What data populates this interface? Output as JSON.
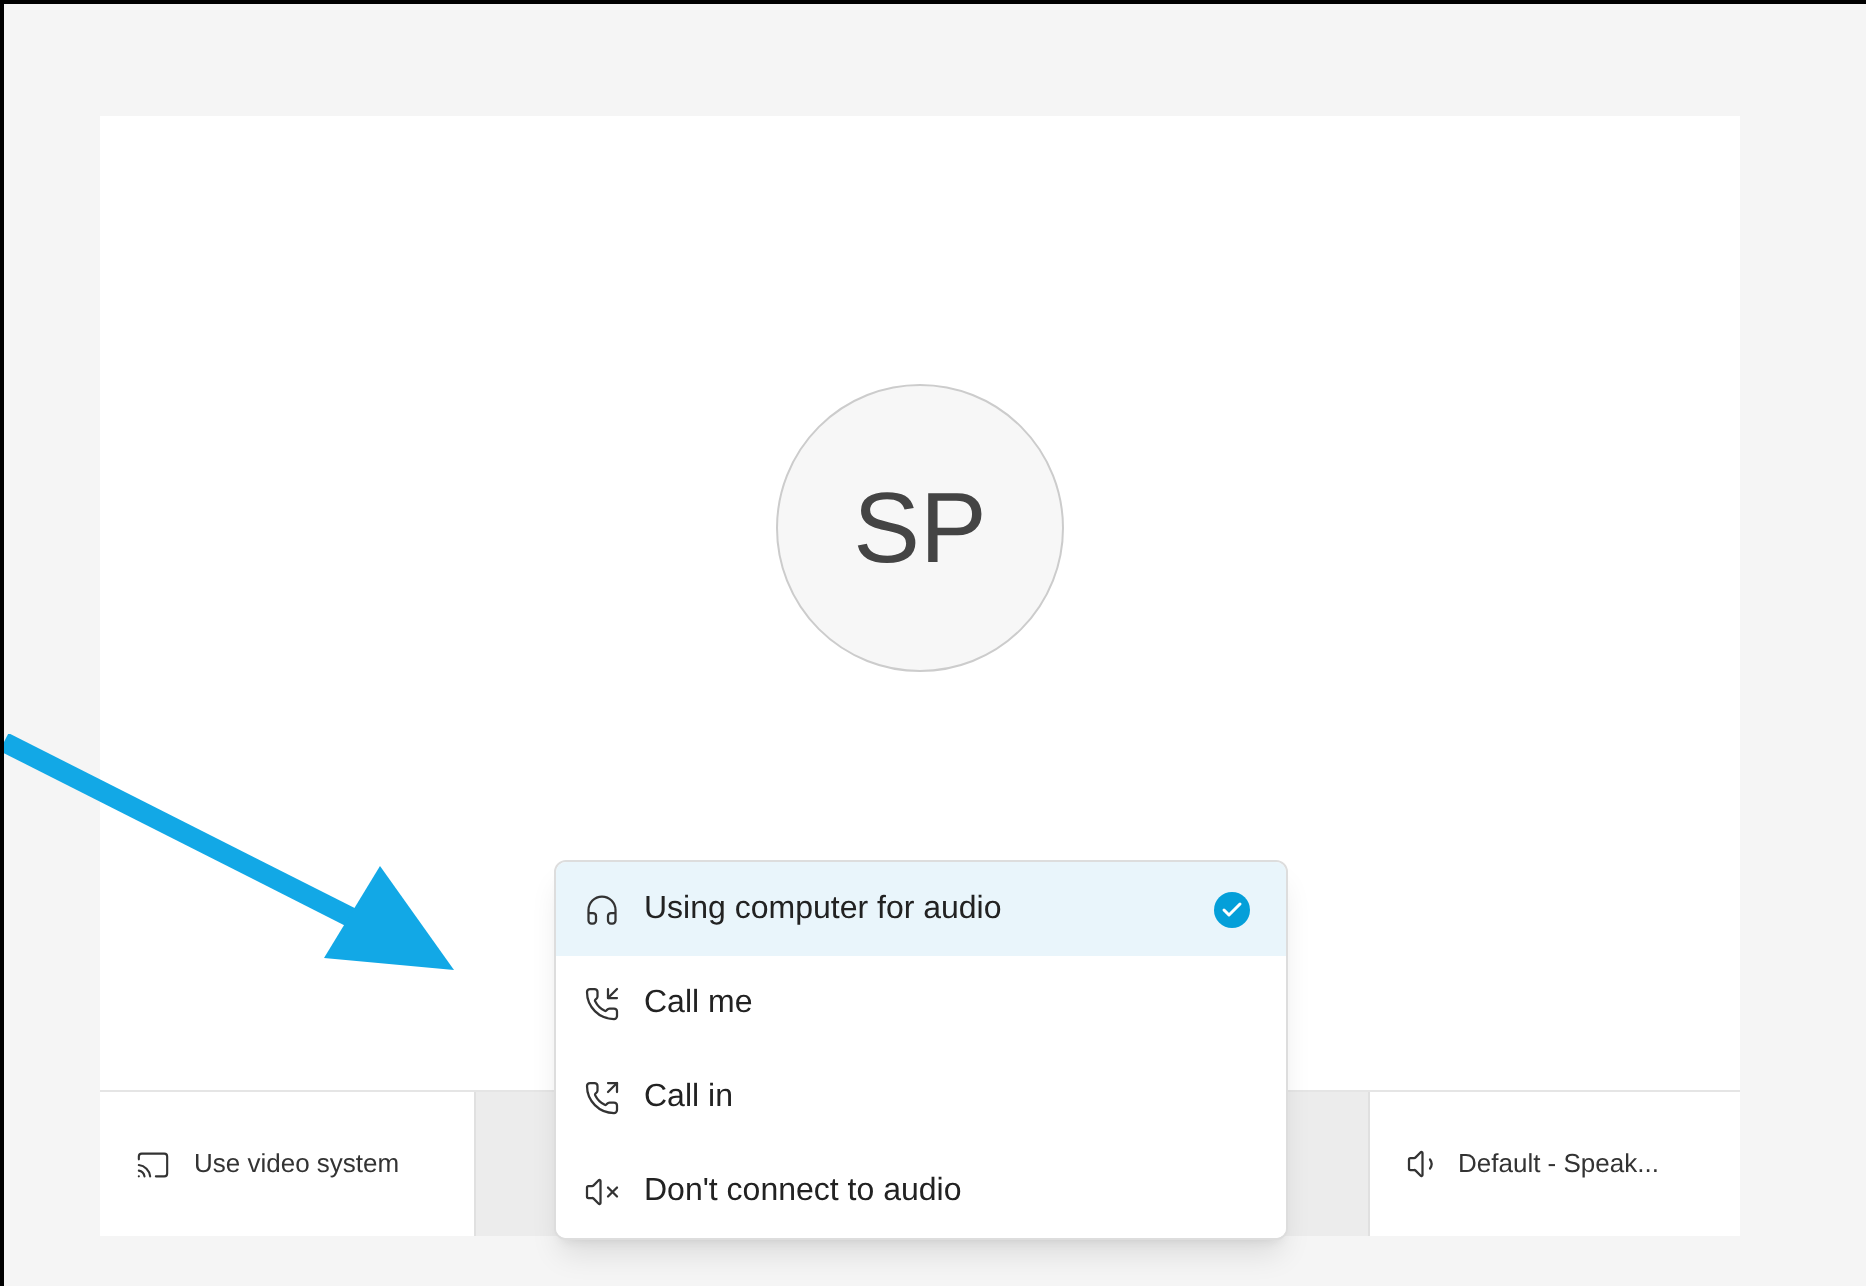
{
  "avatar": {
    "initials": "SP"
  },
  "bottom_bar": {
    "video_button": "Use video system",
    "speaker_button": "Default - Speak..."
  },
  "audio_menu": [
    {
      "kind": "computer",
      "label": "Using computer for audio",
      "selected": true
    },
    {
      "kind": "call_me",
      "label": "Call me",
      "selected": false
    },
    {
      "kind": "call_in",
      "label": "Call in",
      "selected": false
    },
    {
      "kind": "none",
      "label": "Don't connect to audio",
      "selected": false
    }
  ]
}
